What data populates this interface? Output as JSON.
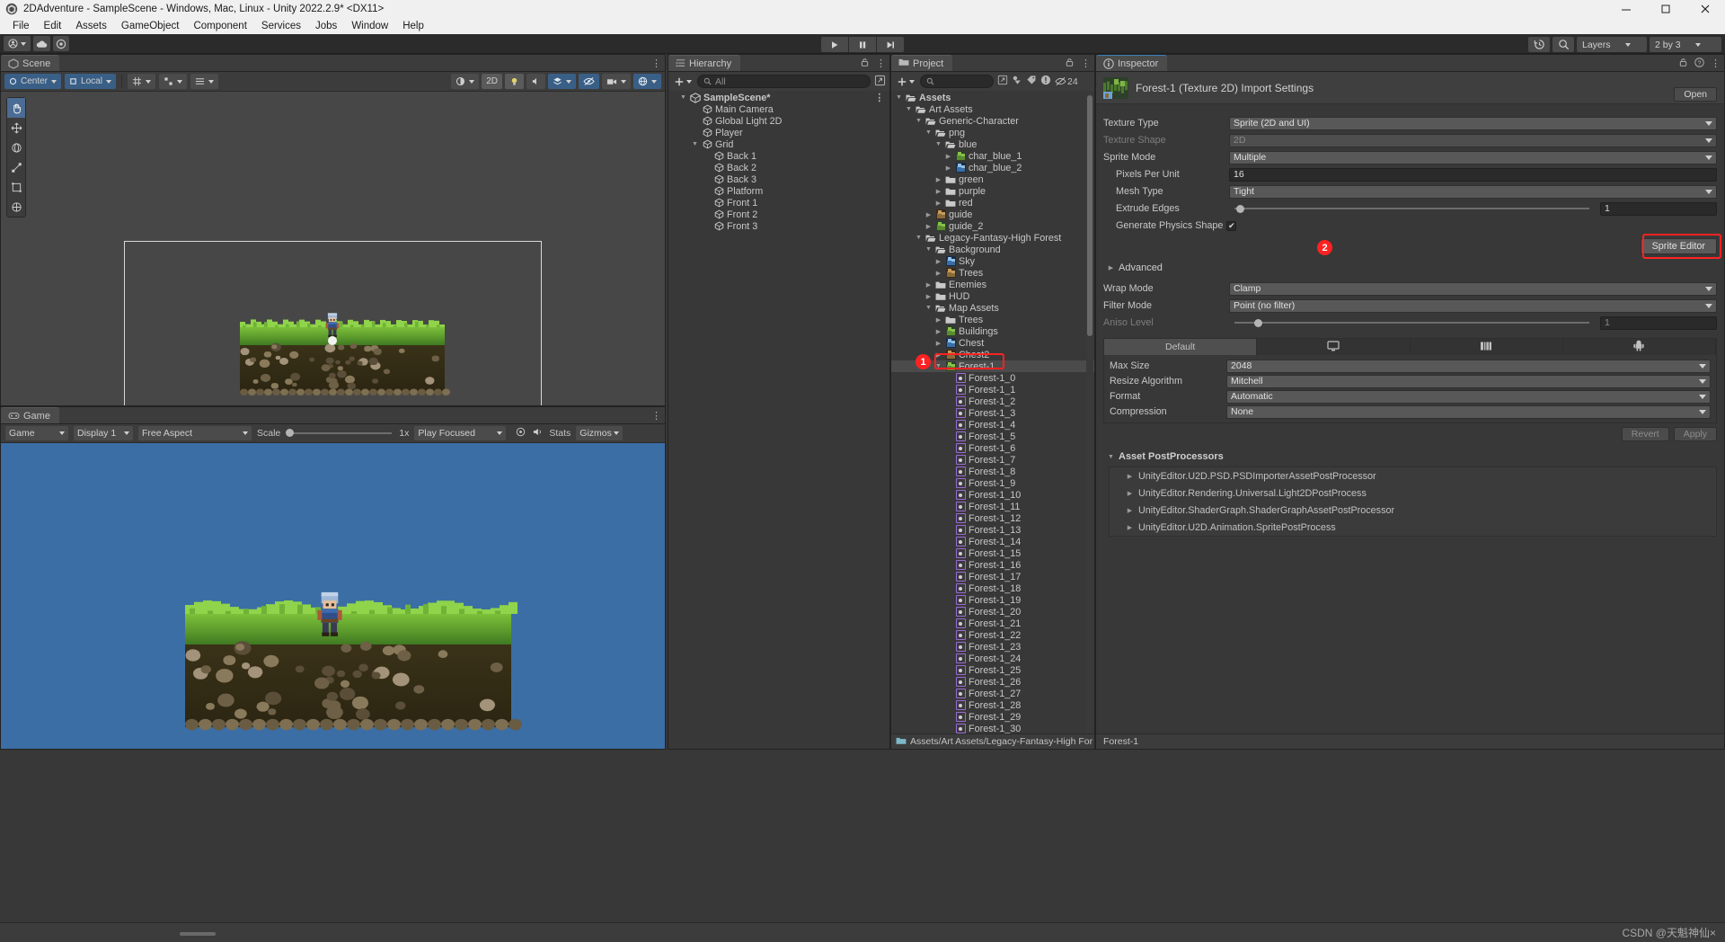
{
  "window": {
    "title": "2DAdventure - SampleScene - Windows, Mac, Linux - Unity 2022.2.9* <DX11>",
    "minimize": "—",
    "maximize": "□",
    "close": "✕"
  },
  "menu": [
    "File",
    "Edit",
    "Assets",
    "GameObject",
    "Component",
    "Services",
    "Jobs",
    "Window",
    "Help"
  ],
  "toolbar": {
    "account_label": "",
    "play": "▶",
    "pause": "❚❚",
    "step": "▶|",
    "history_icon": "history-icon",
    "search_icon": "search-icon",
    "layers_label": "Layers",
    "layout_label": "2 by 3"
  },
  "scene": {
    "tab": "Scene",
    "pivot_mode": "Center",
    "handle_space": "Local",
    "mode_2d": "2D",
    "grid_icon": "grid-icon",
    "snap_icon": "snap-icon",
    "tools": [
      "hand-tool",
      "move-tool",
      "rotate-tool",
      "scale-tool",
      "rect-tool",
      "transform-tool"
    ]
  },
  "game": {
    "tab": "Game",
    "display_label": "Game",
    "display": "Display 1",
    "aspect": "Free Aspect",
    "scale_label": "Scale",
    "scale_value": "1x",
    "play_focused": "Play Focused",
    "stats": "Stats",
    "gizmos": "Gizmos"
  },
  "hierarchy": {
    "tab": "Hierarchy",
    "search_placeholder": "All",
    "add_label": "+",
    "items": [
      {
        "label": "SampleScene*",
        "depth": 0,
        "arrow": "down",
        "icon": "scene-icon",
        "bold": true
      },
      {
        "label": "Main Camera",
        "depth": 1,
        "arrow": "none",
        "icon": "gameobject-icon"
      },
      {
        "label": "Global Light 2D",
        "depth": 1,
        "arrow": "none",
        "icon": "gameobject-icon"
      },
      {
        "label": "Player",
        "depth": 1,
        "arrow": "none",
        "icon": "gameobject-icon"
      },
      {
        "label": "Grid",
        "depth": 1,
        "arrow": "down",
        "icon": "gameobject-icon"
      },
      {
        "label": "Back 1",
        "depth": 2,
        "arrow": "none",
        "icon": "gameobject-icon"
      },
      {
        "label": "Back 2",
        "depth": 2,
        "arrow": "none",
        "icon": "gameobject-icon"
      },
      {
        "label": "Back 3",
        "depth": 2,
        "arrow": "none",
        "icon": "gameobject-icon"
      },
      {
        "label": "Platform",
        "depth": 2,
        "arrow": "none",
        "icon": "gameobject-icon"
      },
      {
        "label": "Front 1",
        "depth": 2,
        "arrow": "none",
        "icon": "gameobject-icon"
      },
      {
        "label": "Front 2",
        "depth": 2,
        "arrow": "none",
        "icon": "gameobject-icon"
      },
      {
        "label": "Front 3",
        "depth": 2,
        "arrow": "none",
        "icon": "gameobject-icon"
      }
    ]
  },
  "project": {
    "tab": "Project",
    "search_placeholder": "",
    "hidden_count": "24",
    "footer_path": "Assets/Art Assets/Legacy-Fantasy-High For",
    "items": [
      {
        "label": "Assets",
        "depth": 0,
        "arrow": "down",
        "icon": "folder-open",
        "bold": true
      },
      {
        "label": "Art Assets",
        "depth": 1,
        "arrow": "down",
        "icon": "folder-open"
      },
      {
        "label": "Generic-Character",
        "depth": 2,
        "arrow": "down",
        "icon": "folder-open"
      },
      {
        "label": "png",
        "depth": 3,
        "arrow": "down",
        "icon": "folder-open"
      },
      {
        "label": "blue",
        "depth": 4,
        "arrow": "down",
        "icon": "folder-open"
      },
      {
        "label": "char_blue_1",
        "depth": 5,
        "arrow": "right",
        "icon": "texture-icon"
      },
      {
        "label": "char_blue_2",
        "depth": 5,
        "arrow": "right",
        "icon": "texture-icon"
      },
      {
        "label": "green",
        "depth": 4,
        "arrow": "right",
        "icon": "folder"
      },
      {
        "label": "purple",
        "depth": 4,
        "arrow": "right",
        "icon": "folder"
      },
      {
        "label": "red",
        "depth": 4,
        "arrow": "right",
        "icon": "folder"
      },
      {
        "label": "guide",
        "depth": 3,
        "arrow": "right",
        "icon": "texture-icon"
      },
      {
        "label": "guide_2",
        "depth": 3,
        "arrow": "right",
        "icon": "texture-icon"
      },
      {
        "label": "Legacy-Fantasy-High Forest",
        "depth": 2,
        "arrow": "down",
        "icon": "folder-open"
      },
      {
        "label": "Background",
        "depth": 3,
        "arrow": "down",
        "icon": "folder-open"
      },
      {
        "label": "Sky",
        "depth": 4,
        "arrow": "right",
        "icon": "texture-icon"
      },
      {
        "label": "Trees",
        "depth": 4,
        "arrow": "right",
        "icon": "texture-icon"
      },
      {
        "label": "Enemies",
        "depth": 3,
        "arrow": "right",
        "icon": "folder"
      },
      {
        "label": "HUD",
        "depth": 3,
        "arrow": "right",
        "icon": "folder"
      },
      {
        "label": "Map Assets",
        "depth": 3,
        "arrow": "down",
        "icon": "folder-open"
      },
      {
        "label": "Trees",
        "depth": 4,
        "arrow": "right",
        "icon": "folder"
      },
      {
        "label": "Buildings",
        "depth": 4,
        "arrow": "right",
        "icon": "texture-icon"
      },
      {
        "label": "Chest",
        "depth": 4,
        "arrow": "right",
        "icon": "texture-icon"
      },
      {
        "label": "Chest2",
        "depth": 4,
        "arrow": "right",
        "icon": "texture-icon"
      },
      {
        "label": "Forest-1",
        "depth": 4,
        "arrow": "down",
        "icon": "texture-icon",
        "selected": true
      },
      {
        "label": "Forest-1_0",
        "depth": 5,
        "arrow": "none",
        "icon": "sprite-icon"
      },
      {
        "label": "Forest-1_1",
        "depth": 5,
        "arrow": "none",
        "icon": "sprite-icon"
      },
      {
        "label": "Forest-1_2",
        "depth": 5,
        "arrow": "none",
        "icon": "sprite-icon"
      },
      {
        "label": "Forest-1_3",
        "depth": 5,
        "arrow": "none",
        "icon": "sprite-icon"
      },
      {
        "label": "Forest-1_4",
        "depth": 5,
        "arrow": "none",
        "icon": "sprite-icon"
      },
      {
        "label": "Forest-1_5",
        "depth": 5,
        "arrow": "none",
        "icon": "sprite-icon"
      },
      {
        "label": "Forest-1_6",
        "depth": 5,
        "arrow": "none",
        "icon": "sprite-icon"
      },
      {
        "label": "Forest-1_7",
        "depth": 5,
        "arrow": "none",
        "icon": "sprite-icon"
      },
      {
        "label": "Forest-1_8",
        "depth": 5,
        "arrow": "none",
        "icon": "sprite-icon"
      },
      {
        "label": "Forest-1_9",
        "depth": 5,
        "arrow": "none",
        "icon": "sprite-icon"
      },
      {
        "label": "Forest-1_10",
        "depth": 5,
        "arrow": "none",
        "icon": "sprite-icon"
      },
      {
        "label": "Forest-1_11",
        "depth": 5,
        "arrow": "none",
        "icon": "sprite-icon"
      },
      {
        "label": "Forest-1_12",
        "depth": 5,
        "arrow": "none",
        "icon": "sprite-icon"
      },
      {
        "label": "Forest-1_13",
        "depth": 5,
        "arrow": "none",
        "icon": "sprite-icon"
      },
      {
        "label": "Forest-1_14",
        "depth": 5,
        "arrow": "none",
        "icon": "sprite-icon"
      },
      {
        "label": "Forest-1_15",
        "depth": 5,
        "arrow": "none",
        "icon": "sprite-icon"
      },
      {
        "label": "Forest-1_16",
        "depth": 5,
        "arrow": "none",
        "icon": "sprite-icon"
      },
      {
        "label": "Forest-1_17",
        "depth": 5,
        "arrow": "none",
        "icon": "sprite-icon"
      },
      {
        "label": "Forest-1_18",
        "depth": 5,
        "arrow": "none",
        "icon": "sprite-icon"
      },
      {
        "label": "Forest-1_19",
        "depth": 5,
        "arrow": "none",
        "icon": "sprite-icon"
      },
      {
        "label": "Forest-1_20",
        "depth": 5,
        "arrow": "none",
        "icon": "sprite-icon"
      },
      {
        "label": "Forest-1_21",
        "depth": 5,
        "arrow": "none",
        "icon": "sprite-icon"
      },
      {
        "label": "Forest-1_22",
        "depth": 5,
        "arrow": "none",
        "icon": "sprite-icon"
      },
      {
        "label": "Forest-1_23",
        "depth": 5,
        "arrow": "none",
        "icon": "sprite-icon"
      },
      {
        "label": "Forest-1_24",
        "depth": 5,
        "arrow": "none",
        "icon": "sprite-icon"
      },
      {
        "label": "Forest-1_25",
        "depth": 5,
        "arrow": "none",
        "icon": "sprite-icon"
      },
      {
        "label": "Forest-1_26",
        "depth": 5,
        "arrow": "none",
        "icon": "sprite-icon"
      },
      {
        "label": "Forest-1_27",
        "depth": 5,
        "arrow": "none",
        "icon": "sprite-icon"
      },
      {
        "label": "Forest-1_28",
        "depth": 5,
        "arrow": "none",
        "icon": "sprite-icon"
      },
      {
        "label": "Forest-1_29",
        "depth": 5,
        "arrow": "none",
        "icon": "sprite-icon"
      },
      {
        "label": "Forest-1_30",
        "depth": 5,
        "arrow": "none",
        "icon": "sprite-icon"
      }
    ]
  },
  "inspector": {
    "tab": "Inspector",
    "asset_title": "Forest-1 (Texture 2D) Import Settings",
    "open_label": "Open",
    "fields": [
      {
        "label": "Texture Type",
        "value": "Sprite (2D and UI)",
        "type": "dropdown"
      },
      {
        "label": "Texture Shape",
        "value": "2D",
        "type": "dropdown",
        "disabled": true
      },
      {
        "label": "Sprite Mode",
        "value": "Multiple",
        "type": "dropdown"
      },
      {
        "label": "Pixels Per Unit",
        "value": "16",
        "type": "input",
        "indent": 1
      },
      {
        "label": "Mesh Type",
        "value": "Tight",
        "type": "dropdown",
        "indent": 1
      },
      {
        "label": "Extrude Edges",
        "value": "1",
        "type": "slider",
        "indent": 1,
        "knob_pct": 2
      },
      {
        "label": "Generate Physics Shape",
        "value": "✔",
        "type": "checkbox",
        "indent": 1
      }
    ],
    "sprite_editor_label": "Sprite Editor",
    "advanced_label": "Advanced",
    "fields2": [
      {
        "label": "Wrap Mode",
        "value": "Clamp",
        "type": "dropdown"
      },
      {
        "label": "Filter Mode",
        "value": "Point (no filter)",
        "type": "dropdown"
      },
      {
        "label": "Aniso Level",
        "value": "1",
        "type": "slider",
        "disabled": true,
        "knob_pct": 7
      }
    ],
    "platform_tabs": [
      {
        "label": "Default",
        "icon": "",
        "active": true
      },
      {
        "label": "",
        "icon": "standalone-icon"
      },
      {
        "label": "",
        "icon": "webgl-icon"
      },
      {
        "label": "",
        "icon": "android-icon"
      }
    ],
    "platform_fields": [
      {
        "label": "Max Size",
        "value": "2048"
      },
      {
        "label": "Resize Algorithm",
        "value": "Mitchell"
      },
      {
        "label": "Format",
        "value": "Automatic"
      },
      {
        "label": "Compression",
        "value": "None"
      }
    ],
    "revert_label": "Revert",
    "apply_label": "Apply",
    "postprocessors_title": "Asset PostProcessors",
    "postprocessors": [
      "UnityEditor.U2D.PSD.PSDImporterAssetPostProcessor",
      "UnityEditor.Rendering.Universal.Light2DPostProcess",
      "UnityEditor.ShaderGraph.ShaderGraphAssetPostProcessor",
      "UnityEditor.U2D.Animation.SpritePostProcess"
    ],
    "footer": "Forest-1"
  },
  "annotations": [
    {
      "number": "1",
      "target": "project-forest-1-row"
    },
    {
      "number": "2",
      "target": "sprite-editor-button"
    }
  ],
  "watermark": "CSDN @天魁神仙×",
  "colors": {
    "accent_blue": "#3a5f86",
    "annotation_red": "#ff2222",
    "panel_bg": "#383838",
    "sky_blue": "#3b6ea5"
  }
}
